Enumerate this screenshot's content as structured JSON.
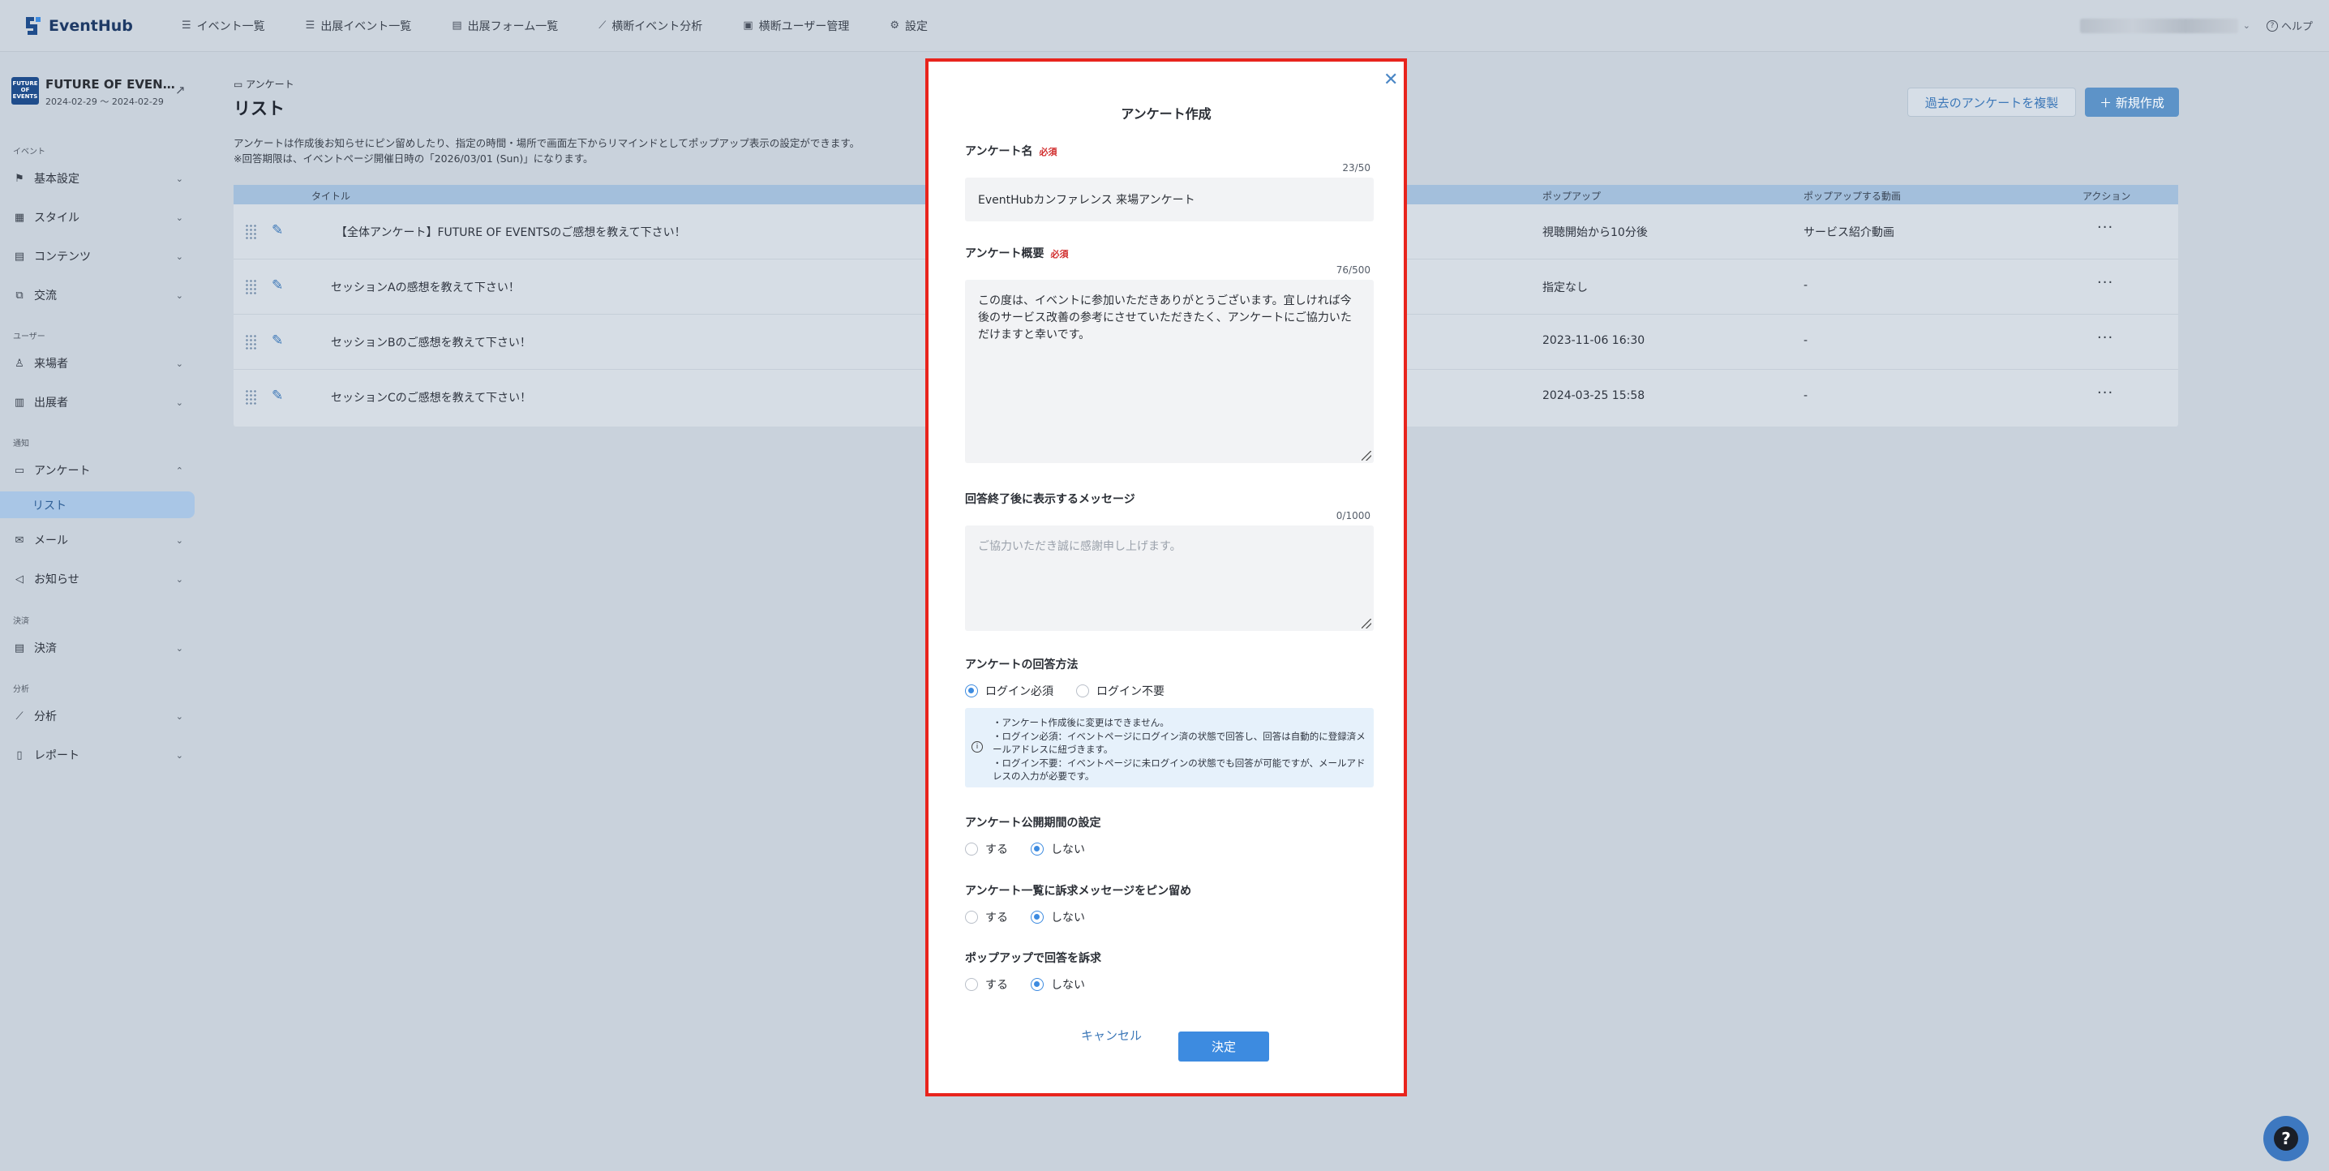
{
  "app": {
    "logo_text": "EventHub"
  },
  "nav": {
    "items": [
      {
        "label": "イベント一覧",
        "icon": "list-icon",
        "glyph": "☰"
      },
      {
        "label": "出展イベント一覧",
        "icon": "list-icon",
        "glyph": "☰"
      },
      {
        "label": "出展フォーム一覧",
        "icon": "form-icon",
        "glyph": "▤"
      },
      {
        "label": "横断イベント分析",
        "icon": "chart-icon",
        "glyph": "⟋"
      },
      {
        "label": "横断ユーザー管理",
        "icon": "user-card-icon",
        "glyph": "▣"
      },
      {
        "label": "設定",
        "icon": "gear-icon",
        "glyph": "⚙"
      }
    ],
    "help_label": "ヘルプ"
  },
  "event": {
    "name": "FUTURE OF EVEN…",
    "dates": "2024-02-29 〜 2024-02-29",
    "thumb_text": "FUTURE OF EVENTS"
  },
  "sidebar": {
    "sections": {
      "event": "イベント",
      "user": "ユーザー",
      "notice": "通知",
      "payment": "決済",
      "analysis": "分析"
    },
    "items": {
      "basic": "基本設定",
      "style": "スタイル",
      "content": "コンテンツ",
      "exchange": "交流",
      "visitor": "来場者",
      "exhibitor": "出展者",
      "survey": "アンケート",
      "survey_list": "リスト",
      "mail": "メール",
      "news": "お知らせ",
      "payment": "決済",
      "analysis": "分析",
      "report": "レポート"
    }
  },
  "main": {
    "breadcrumb": "アンケート",
    "title": "リスト",
    "desc_line1": "アンケートは作成後お知らせにピン留めしたり、指定の時間・場所で画面左下からリマインドとしてポップアップ表示の設定ができます。",
    "desc_line2": "※回答期限は、イベントページ開催日時の「2026/03/01 (Sun)」になります。",
    "copy_button": "過去のアンケートを複製",
    "new_button": "＋ 新規作成",
    "columns": {
      "title": "タイトル",
      "popup": "ポップアップ",
      "popup_video": "ポップアップする動画",
      "action": "アクション"
    },
    "rows": [
      {
        "title": "【全体アンケート】FUTURE OF EVENTSのご感想を教えて下さい！",
        "popup": "視聴開始から10分後",
        "video": "サービス紹介動画"
      },
      {
        "title": "セッションAの感想を教えて下さい！",
        "popup": "指定なし",
        "video": "-"
      },
      {
        "title": "セッションBのご感想を教えて下さい！",
        "popup": "2023-11-06 16:30",
        "video": "-"
      },
      {
        "title": "セッションCのご感想を教えて下さい！",
        "popup": "2024-03-25 15:58",
        "video": "-"
      }
    ]
  },
  "modal": {
    "title": "アンケート作成",
    "required_badge": "必須",
    "name_label": "アンケート名",
    "name_counter": "23/50",
    "name_value": "EventHubカンファレンス 来場アンケート",
    "summary_label": "アンケート概要",
    "summary_counter": "76/500",
    "summary_value": "この度は、イベントに参加いただきありがとうございます。宜しければ今後のサービス改善の参考にさせていただきたく、アンケートにご協力いただけますと幸いです。",
    "message_label": "回答終了後に表示するメッセージ",
    "message_counter": "0/1000",
    "message_placeholder": "ご協力いただき誠に感謝申し上げます。",
    "method_label": "アンケートの回答方法",
    "method_options": [
      "ログイン必須",
      "ログイン不要"
    ],
    "method_selected": "ログイン必須",
    "info_lines": [
      "・アンケート作成後に変更はできません。",
      "・ログイン必須：イベントページにログイン済の状態で回答し、回答は自動的に登録済メールアドレスに紐づきます。",
      "・ログイン不要：イベントページに未ログインの状態でも回答が可能ですが、メールアドレスの入力が必要です。"
    ],
    "period_label": "アンケート公開期間の設定",
    "pin_label": "アンケート一覧に訴求メッセージをピン留め",
    "popup_label": "ポップアップで回答を訴求",
    "yes": "する",
    "no": "しない",
    "period_selected": "しない",
    "pin_selected": "しない",
    "popup_selected": "しない",
    "cancel": "キャンセル",
    "confirm": "決定"
  },
  "colors": {
    "accent": "#3d8be0",
    "required": "#d12d2d",
    "highlight_border": "#e8241d"
  }
}
